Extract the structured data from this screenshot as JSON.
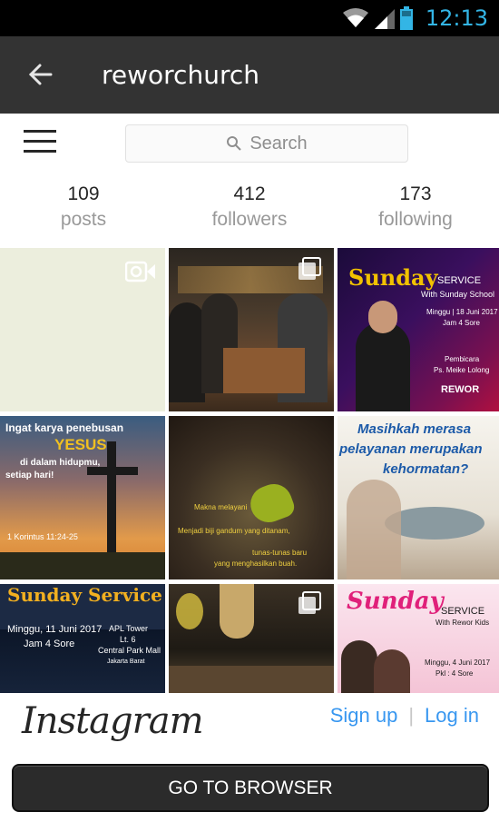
{
  "status_bar": {
    "time": "12:13",
    "icons": [
      "wifi-icon",
      "signal-icon",
      "battery-icon"
    ],
    "accent": "#33b5e5"
  },
  "app_bar": {
    "title": "reworchurch",
    "back_icon": "arrow-left-icon"
  },
  "toolbar": {
    "menu_icon": "hamburger-menu-icon",
    "search_placeholder": "Search",
    "search_icon": "magnifier-icon"
  },
  "profile_stats": [
    {
      "count": "109",
      "label": "posts"
    },
    {
      "count": "412",
      "label": "followers"
    },
    {
      "count": "173",
      "label": "following"
    }
  ],
  "grid": [
    {
      "kind": "video",
      "texts": []
    },
    {
      "kind": "multi",
      "texts": []
    },
    {
      "kind": "image",
      "texts": [
        "Sunday",
        "SERVICE",
        "With Sunday School",
        "Minggu | 18 Juni 2017",
        "Jam 4 Sore",
        "Pembicara",
        "Ps. Meike Lolong",
        "REWOR"
      ]
    },
    {
      "kind": "image",
      "texts": [
        "Ingat karya penebusan",
        "YESUS",
        "di dalam hidupmu,",
        "setiap hari!",
        "1 Korintus 11:24-25"
      ]
    },
    {
      "kind": "image",
      "texts": [
        "Makna melayani",
        "Menjadi biji gandum yang ditanam,",
        "tunas-tunas baru",
        "yang menghasilkan buah."
      ]
    },
    {
      "kind": "image",
      "texts": [
        "Masihkah merasa",
        "pelayanan merupakan",
        "kehormatan?"
      ]
    },
    {
      "kind": "image",
      "texts": [
        "Sunday Service",
        "Minggu, 11 Juni 2017",
        "Jam 4 Sore",
        "APL Tower",
        "Lt. 6",
        "Central Park Mall",
        "Jakarta Barat"
      ]
    },
    {
      "kind": "multi",
      "texts": []
    },
    {
      "kind": "image",
      "texts": [
        "Sunday",
        "SERVICE",
        "With Rewor Kids",
        "Minggu, 4 Juni 2017",
        "Pkl : 4 Sore"
      ]
    }
  ],
  "footer": {
    "logo_text": "Instagram",
    "sign_up": "Sign up",
    "separator": "|",
    "log_in": "Log in",
    "browser_button": "GO TO BROWSER",
    "link_color": "#3897f0"
  }
}
